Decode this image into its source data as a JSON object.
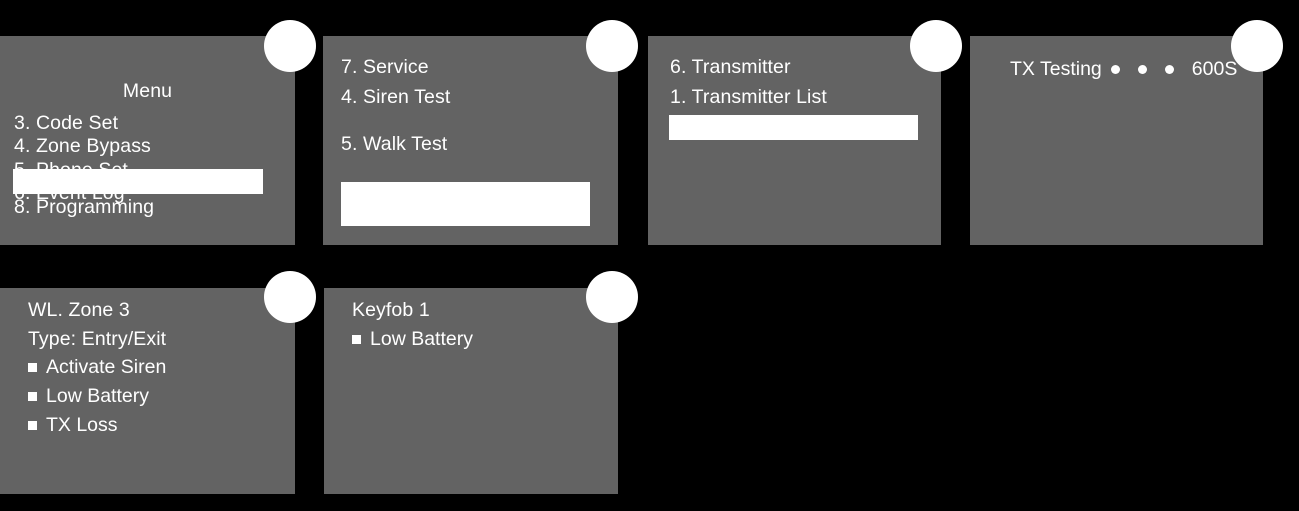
{
  "background_color": "#000000",
  "panel_color": "#636363",
  "highlight_color": "#ffffff",
  "text_color": "#ffffff",
  "panels": [
    {
      "id": "menu-panel",
      "title": "Menu",
      "items": [
        "3. Code Set",
        "4. Zone Bypass",
        "5. Phone Set",
        "6. Event Log"
      ],
      "items_after_highlight": [
        "8. Programming"
      ]
    },
    {
      "id": "service-panel",
      "items": [
        "7. Service",
        "4. Siren Test"
      ],
      "items_after_gap": [
        "5. Walk Test"
      ]
    },
    {
      "id": "transmitter-panel",
      "items": [
        "6. Transmitter",
        "1. Transmitter List"
      ]
    },
    {
      "id": "tx-testing-panel",
      "label": "TX Testing",
      "dot_count": 3,
      "duration": "600S"
    },
    {
      "id": "wl-zone-panel",
      "title": "WL. Zone 3",
      "type_line": "Type: Entry/Exit",
      "options": [
        "Activate Siren",
        "Low Battery",
        "TX Loss"
      ]
    },
    {
      "id": "keyfob-panel",
      "title": "Keyfob 1",
      "options": [
        "Low Battery"
      ]
    }
  ]
}
